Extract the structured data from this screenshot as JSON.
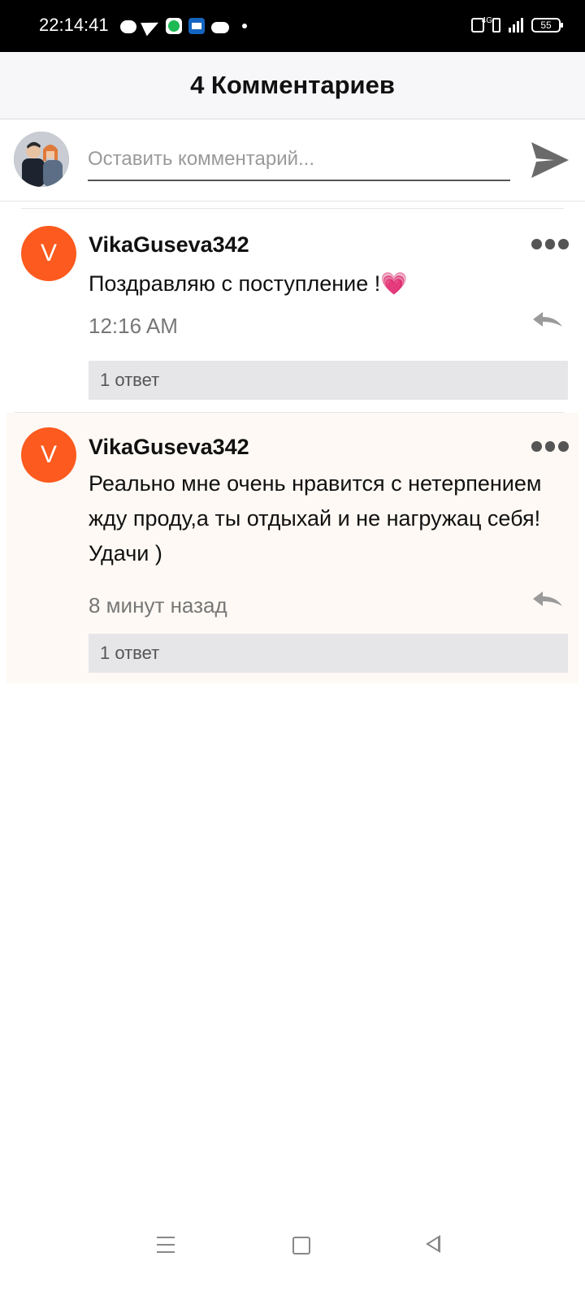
{
  "status_bar": {
    "time": "22:14:41",
    "left_icons": [
      "chat-bubble-icon",
      "telegram-icon",
      "spotify-icon",
      "mail-app-icon",
      "gamepad-icon",
      "dot-icon"
    ],
    "network": "4G",
    "battery": "55"
  },
  "header": {
    "title": "4 Комментариев"
  },
  "composer": {
    "placeholder": "Оставить комментарий...",
    "send_icon": "send-icon"
  },
  "comments": [
    {
      "avatar_letter": "V",
      "username": "VikaGuseva342",
      "text": "Поздравляю с поступление !💗",
      "time": "12:16 AM",
      "replies": "1 ответ"
    },
    {
      "avatar_letter": "V",
      "username": "VikaGuseva342",
      "text": "Реально мне очень нравится с нетерпением жду проду,а ты отдыхай и не нагружац себя!Удачи )",
      "time": "8 минут назад",
      "replies": "1 ответ"
    }
  ],
  "colors": {
    "avatar": "#fc5a1e",
    "highlight": "#fef9f4",
    "replies_bar": "#e6e5e8",
    "header_bg": "#f7f6f8"
  }
}
